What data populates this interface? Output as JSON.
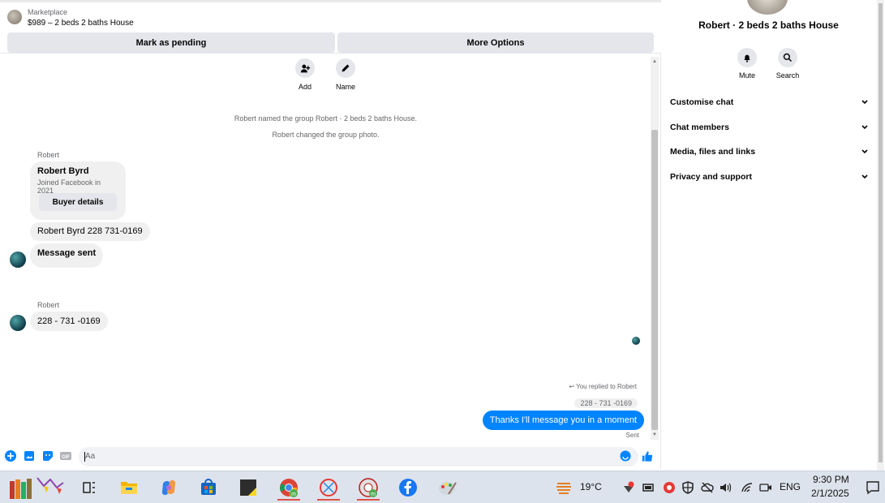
{
  "header": {
    "subtitle": "Marketplace",
    "title": "$989 – 2 beds 2 baths House",
    "buttons": {
      "pending": "Mark as pending",
      "more": "More Options"
    }
  },
  "actions": {
    "add": "Add",
    "name": "Name"
  },
  "system_messages": [
    "Robert named the group Robert · 2 beds 2 baths House.",
    "Robert changed the group photo."
  ],
  "messages": {
    "sender_1": "Robert",
    "card": {
      "name": "Robert Byrd",
      "joined": "Joined Facebook in 2021",
      "button": "Buyer details"
    },
    "phone_msg": "Robert Byrd 228 731-0169",
    "sent_msg": "Message sent",
    "sender_2": "Robert",
    "phone_msg_2": "228 - 731 -0169",
    "reply_note": "You replied to Robert",
    "reply_ref": "228 - 731 -0169",
    "outgoing": "Thanks I'll message you in a moment",
    "status": "Sent"
  },
  "composer": {
    "placeholder": "Aa"
  },
  "details": {
    "title": "Robert · 2 beds 2 baths House",
    "mute": "Mute",
    "search": "Search",
    "sections": [
      "Customise chat",
      "Chat members",
      "Media, files and links",
      "Privacy and support"
    ]
  },
  "taskbar": {
    "weather": "19°C",
    "language": "ENG",
    "time": "9:30 PM",
    "date": "2/1/2025"
  },
  "colors": {
    "accent": "#0084ff",
    "bubble": "#f0f0f0",
    "button": "#e4e6eb"
  }
}
